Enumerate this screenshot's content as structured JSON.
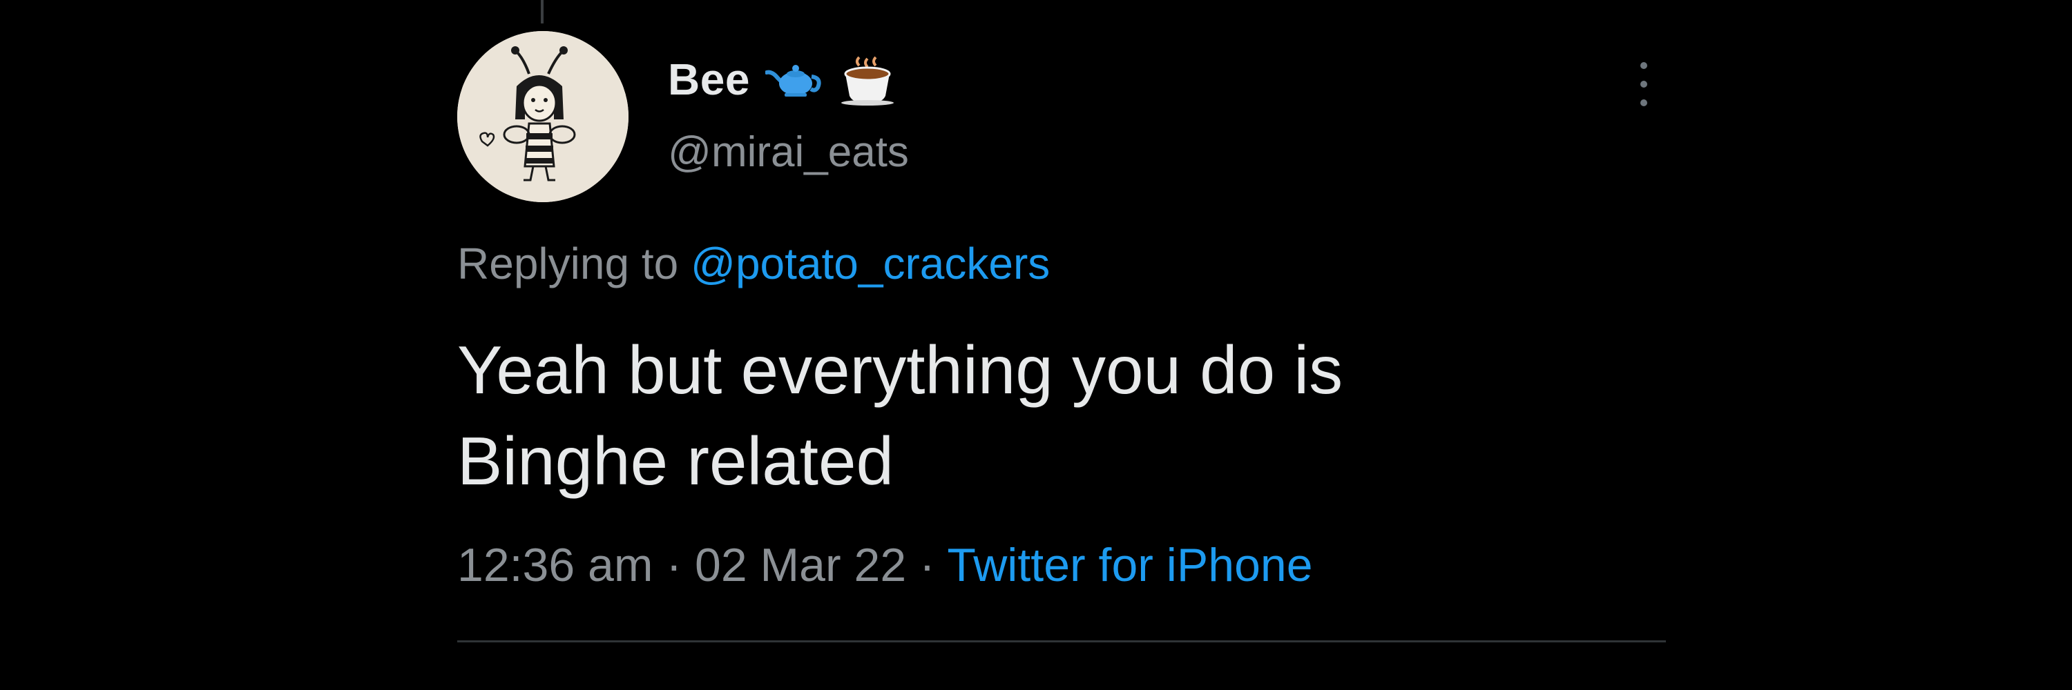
{
  "tweet": {
    "author": {
      "display_name": "Bee",
      "emojis": [
        "teapot-emoji",
        "hot-beverage-emoji"
      ],
      "handle": "@mirai_eats",
      "avatar_icon": "bee-drawing-avatar"
    },
    "reply_prefix": "Replying to ",
    "reply_to": "@potato_crackers",
    "text": "Yeah but everything you do is\nBinghe related",
    "time": "12:36 am",
    "separator": "·",
    "date": "02 Mar 22",
    "source": "Twitter for iPhone",
    "more_icon": "more-vertical-icon"
  },
  "colors": {
    "background": "#000000",
    "primary_text": "#e7e9ea",
    "secondary_text": "#8b9095",
    "accent": "#1d9bf0",
    "divider": "#2f3336"
  }
}
